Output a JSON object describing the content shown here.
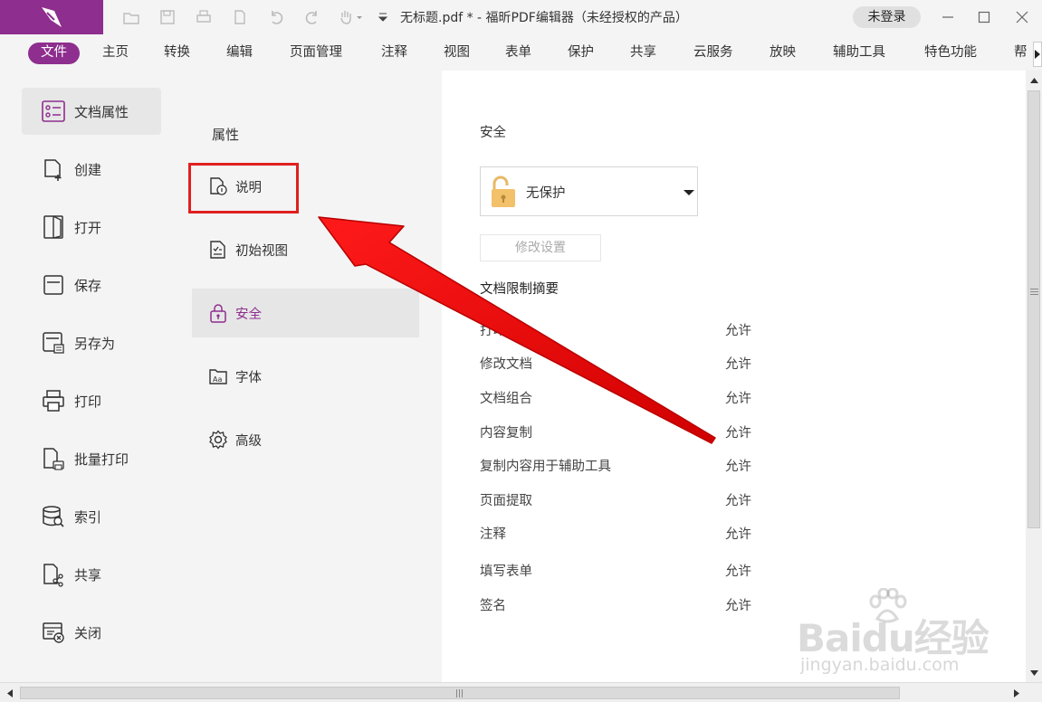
{
  "titlebar": {
    "doc_title": "无标题.pdf * - 福昕PDF编辑器（未经授权的产品）",
    "login_label": "未登录"
  },
  "colors": {
    "brand": "#8e2e8e",
    "annotation": "#e02020",
    "lock": "#f2c169"
  },
  "menu": {
    "items": [
      "文件",
      "主页",
      "转换",
      "编辑",
      "页面管理",
      "注释",
      "视图",
      "表单",
      "保护",
      "共享",
      "云服务",
      "放映",
      "辅助工具",
      "特色功能",
      "帮"
    ],
    "active": "文件"
  },
  "leftnav": {
    "items": [
      {
        "label": "文档属性",
        "icon": "doc-properties-icon"
      },
      {
        "label": "创建",
        "icon": "create-icon"
      },
      {
        "label": "打开",
        "icon": "open-icon"
      },
      {
        "label": "保存",
        "icon": "save-icon"
      },
      {
        "label": "另存为",
        "icon": "save-as-icon"
      },
      {
        "label": "打印",
        "icon": "print-icon"
      },
      {
        "label": "批量打印",
        "icon": "batch-print-icon"
      },
      {
        "label": "索引",
        "icon": "index-icon"
      },
      {
        "label": "共享",
        "icon": "share-icon"
      },
      {
        "label": "关闭",
        "icon": "close-doc-icon"
      }
    ]
  },
  "midpanel": {
    "title": "属性",
    "items": [
      {
        "label": "说明",
        "icon": "description-icon"
      },
      {
        "label": "初始视图",
        "icon": "initial-view-icon"
      },
      {
        "label": "安全",
        "icon": "security-lock-icon"
      },
      {
        "label": "字体",
        "icon": "font-icon"
      },
      {
        "label": "高级",
        "icon": "gear-icon"
      }
    ],
    "active": "安全"
  },
  "security": {
    "title": "安全",
    "method": "无保护",
    "modify_button": "修改设置",
    "summary_title": "文档限制摘要",
    "rows": [
      {
        "name": "打印",
        "value": "允许"
      },
      {
        "name": "修改文档",
        "value": "允许"
      },
      {
        "name": "文档组合",
        "value": "允许"
      },
      {
        "name": "内容复制",
        "value": "允许"
      },
      {
        "name": "复制内容用于辅助工具",
        "value": "允许"
      },
      {
        "name": "页面提取",
        "value": "允许"
      },
      {
        "name": "注释",
        "value": "允许"
      },
      {
        "name": "填写表单",
        "value": "允许"
      },
      {
        "name": "签名",
        "value": "允许"
      }
    ]
  },
  "watermark": {
    "brand": "Baidu经验",
    "url": "jingyan.baidu.com"
  }
}
